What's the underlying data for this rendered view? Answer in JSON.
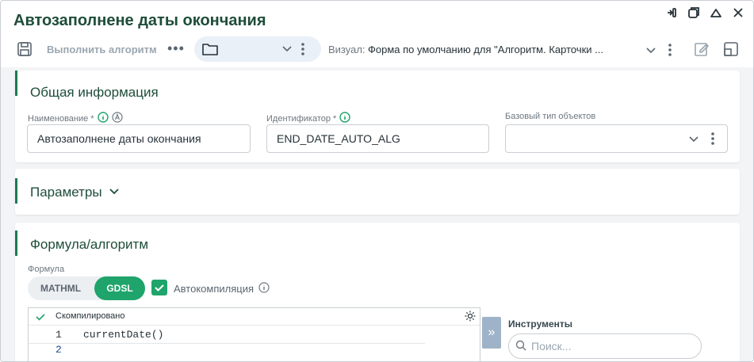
{
  "window": {
    "title": "Автозаполнене даты окончания"
  },
  "toolbar": {
    "run_label": "Выполнить алгоритм",
    "visual_label": "Визуал:",
    "visual_value": "Форма по умолчанию для \"Алгоритм. Карточки ..."
  },
  "general": {
    "title": "Общая информация",
    "name_label": "Наименование *",
    "name_value": "Автозаполнене даты окончания",
    "id_label": "Идентификатор *",
    "id_value": "END_DATE_AUTO_ALG",
    "base_type_label": "Базовый тип объектов",
    "base_type_value": ""
  },
  "params": {
    "title": "Параметры"
  },
  "formula": {
    "title": "Формула/алгоритм",
    "formula_label": "Формула",
    "mathml_label": "MATHML",
    "gdsl_label": "GDSL",
    "autocompile_label": "Автокомпиляция",
    "autocompile_checked": true,
    "status": "Скомпилировано",
    "lines": [
      {
        "num": "1",
        "code": "currentDate()"
      },
      {
        "num": "2",
        "code": ""
      }
    ],
    "tools_label": "Инструменты",
    "search_placeholder": "Поиск..."
  },
  "colors": {
    "accent": "#1fa46b",
    "title_green": "#1e4d3a",
    "bar_green": "#1e7a53"
  }
}
